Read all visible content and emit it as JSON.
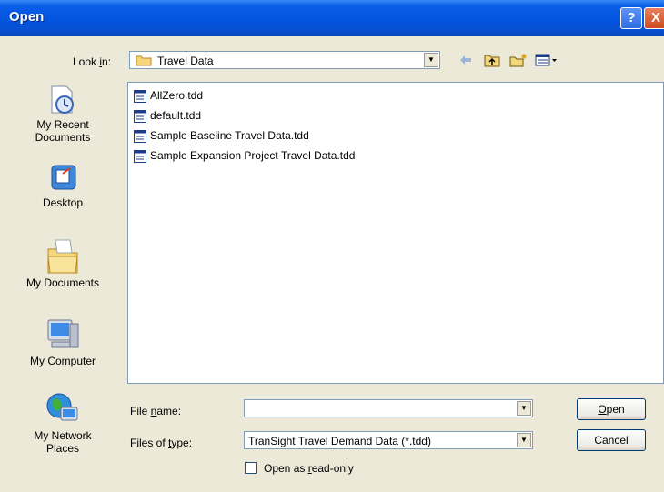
{
  "window": {
    "title": "Open",
    "help": "?",
    "close": "X"
  },
  "lookin": {
    "label_pre": "Look ",
    "label_ul": "i",
    "label_post": "n:",
    "value": "Travel Data"
  },
  "places": [
    {
      "line1": "My Recent",
      "line2": "Documents"
    },
    {
      "line1": "Desktop",
      "line2": ""
    },
    {
      "line1": "My Documents",
      "line2": ""
    },
    {
      "line1": "My Computer",
      "line2": ""
    },
    {
      "line1": "My Network",
      "line2": "Places"
    }
  ],
  "files": [
    "AllZero.tdd",
    "default.tdd",
    "Sample Baseline Travel Data.tdd",
    "Sample Expansion Project Travel Data.tdd"
  ],
  "filename": {
    "label_pre": "File ",
    "label_ul": "n",
    "label_post": "ame:",
    "value": ""
  },
  "filetype": {
    "label_pre": "Files of ",
    "label_ul": "t",
    "label_post": "ype:",
    "value": "TranSight Travel Demand Data (*.tdd)"
  },
  "readonly": {
    "label_pre": "Open as ",
    "label_ul": "r",
    "label_post": "ead-only"
  },
  "buttons": {
    "open_ul": "O",
    "open_post": "pen",
    "cancel": "Cancel"
  }
}
